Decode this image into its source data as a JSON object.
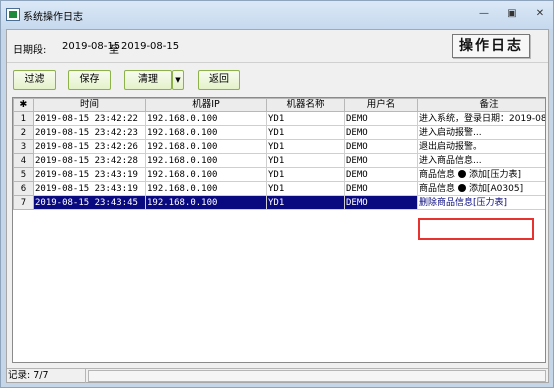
{
  "window": {
    "title": "系统操作日志"
  },
  "period": {
    "label": "日期段:",
    "from": "2019-08-15",
    "to_word": "至",
    "to": "2019-08-15"
  },
  "log_button": "操作日志",
  "toolbar": {
    "filter": "过滤",
    "save": "保存",
    "clear": "清理",
    "back": "返回"
  },
  "table": {
    "columns": [
      "时间",
      "机器IP",
      "机器名称",
      "用户名",
      "备注"
    ],
    "rows": [
      {
        "n": "1",
        "time": "2019-08-15 23:42:22",
        "ip": "192.168.0.100",
        "machine": "YD1",
        "user": "DEMO",
        "note": "进入系统，登录日期：2019-08-"
      },
      {
        "n": "2",
        "time": "2019-08-15 23:42:23",
        "ip": "192.168.0.100",
        "machine": "YD1",
        "user": "DEMO",
        "note": "进入启动报警..."
      },
      {
        "n": "3",
        "time": "2019-08-15 23:42:26",
        "ip": "192.168.0.100",
        "machine": "YD1",
        "user": "DEMO",
        "note": "退出启动报警。"
      },
      {
        "n": "4",
        "time": "2019-08-15 23:42:28",
        "ip": "192.168.0.100",
        "machine": "YD1",
        "user": "DEMO",
        "note": "进入商品信息..."
      },
      {
        "n": "5",
        "time": "2019-08-15 23:43:19",
        "ip": "192.168.0.100",
        "machine": "YD1",
        "user": "DEMO",
        "note_pre": "商品信息",
        "note_post": "添加[压力表]"
      },
      {
        "n": "6",
        "time": "2019-08-15 23:43:19",
        "ip": "192.168.0.100",
        "machine": "YD1",
        "user": "DEMO",
        "note_pre": "商品信息",
        "note_post": "添加[A0305]"
      },
      {
        "n": "7",
        "time": "2019-08-15 23:43:45",
        "ip": "192.168.0.100",
        "machine": "YD1",
        "user": "DEMO",
        "note": "删除商品信息[压力表]"
      }
    ]
  },
  "status": {
    "records": "记录: 7/7"
  }
}
